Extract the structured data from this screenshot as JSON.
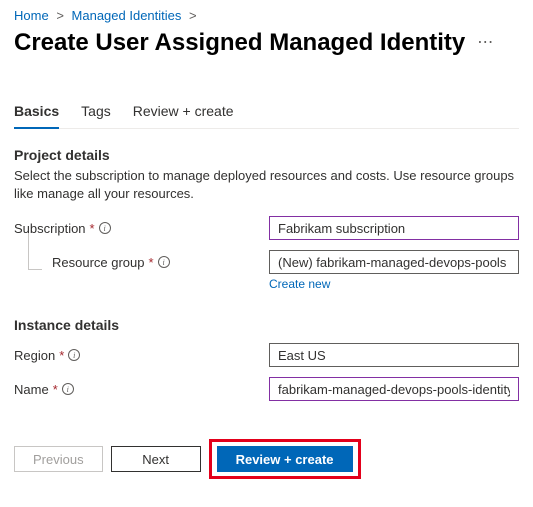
{
  "breadcrumb": {
    "home": "Home",
    "parent": "Managed Identities"
  },
  "page": {
    "title": "Create User Assigned Managed Identity"
  },
  "tabs": {
    "basics": "Basics",
    "tags": "Tags",
    "review": "Review + create"
  },
  "project": {
    "heading": "Project details",
    "description": "Select the subscription to manage deployed resources and costs. Use resource groups like manage all your resources.",
    "subscription_label": "Subscription",
    "subscription_value": "Fabrikam subscription",
    "resource_group_label": "Resource group",
    "resource_group_value": "(New) fabrikam-managed-devops-pools",
    "create_new": "Create new"
  },
  "instance": {
    "heading": "Instance details",
    "region_label": "Region",
    "region_value": "East US",
    "name_label": "Name",
    "name_value": "fabrikam-managed-devops-pools-identity"
  },
  "footer": {
    "previous": "Previous",
    "next": "Next",
    "review_create": "Review + create"
  }
}
